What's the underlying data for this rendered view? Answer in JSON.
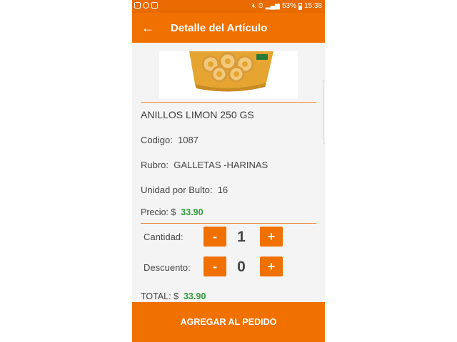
{
  "status_bar": {
    "battery": "53%",
    "time": "15:38"
  },
  "app_bar": {
    "title": "Detalle del Artículo"
  },
  "product": {
    "name": "ANILLOS LIMON 250 GS",
    "code_label": "Codigo:",
    "code": "1087",
    "category_label": "Rubro:",
    "category": "GALLETAS -HARINAS",
    "units_label": "Unidad por Bulto:",
    "units": "16",
    "price_label": "Precio: $",
    "price": "33.90"
  },
  "order": {
    "quantity_label": "Cantidad:",
    "quantity": "1",
    "discount_label": "Descuento:",
    "discount": "0",
    "minus": "-",
    "plus": "+",
    "total_label": "TOTAL: $",
    "total": "33.90"
  },
  "add_button": "AGREGAR AL PEDIDO",
  "colors": {
    "accent": "#f07000",
    "price_green": "#2e9c3a"
  }
}
